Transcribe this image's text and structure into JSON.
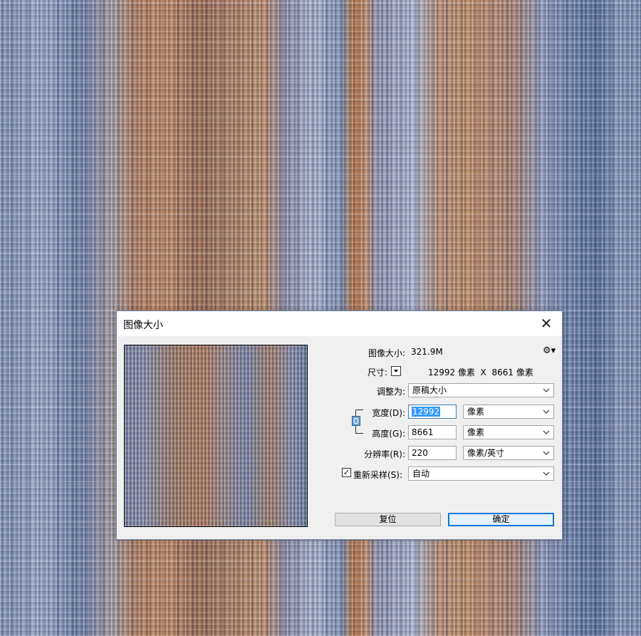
{
  "dialog": {
    "title": "图像大小",
    "close_glyph": "✕"
  },
  "info": {
    "image_size_label": "图像大小:",
    "image_size_value": "321.9M",
    "dimensions_label": "尺寸:",
    "dimensions_value": "12992 像素  X  8661 像素"
  },
  "fit_to": {
    "label": "调整为:",
    "value": "原稿大小"
  },
  "width": {
    "label": "宽度(D):",
    "value": "12992",
    "unit": "像素"
  },
  "height": {
    "label": "高度(G):",
    "value": "8661",
    "unit": "像素"
  },
  "resolution": {
    "label": "分辨率(R):",
    "value": "220",
    "unit": "像素/英寸"
  },
  "resample": {
    "label": "重新采样(S):",
    "checked": true,
    "check_glyph": "✓",
    "value": "自动"
  },
  "buttons": {
    "reset": "复位",
    "ok": "确定"
  },
  "icons": {
    "gear": "gear-icon",
    "link": "link-icon",
    "chevron": "chevron-down-icon"
  },
  "colors": {
    "accent": "#0078d7",
    "selection": "#3399ff"
  }
}
